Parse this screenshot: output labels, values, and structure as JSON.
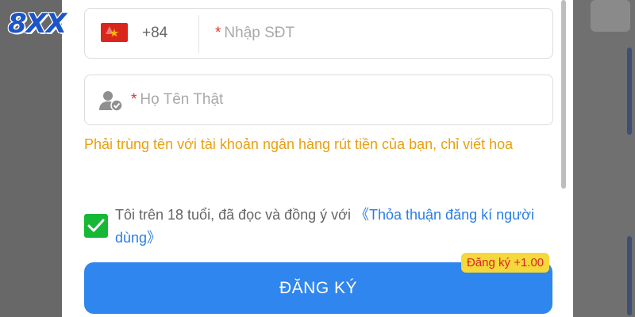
{
  "brand": {
    "logo_text": "8XX"
  },
  "form": {
    "phone": {
      "country_code": "+84",
      "required_mark": "*",
      "placeholder": "Nhập SĐT"
    },
    "name": {
      "required_mark": "*",
      "placeholder": "Họ Tên Thật"
    },
    "name_hint": "Phải trùng tên với tài khoản ngân hàng rút tiền của bạn, chỉ viết hoa",
    "consent": {
      "checked": true,
      "text": "Tôi trên 18 tuổi, đã đọc và đồng ý với ",
      "link": "《Thỏa thuận đăng kí người dùng》"
    },
    "submit_label": "ĐĂNG KÝ",
    "bonus_badge": "Đăng ký +1.00"
  },
  "colors": {
    "primary": "#2f86ee",
    "hint": "#e8a010",
    "checkbox": "#16b835",
    "required": "#e0372c",
    "badge_bg": "#f5d83a",
    "badge_text": "#d62828"
  },
  "icons": [
    "vietnam-flag-icon",
    "user-verified-icon",
    "check-icon",
    "dragon-logo-icon"
  ]
}
